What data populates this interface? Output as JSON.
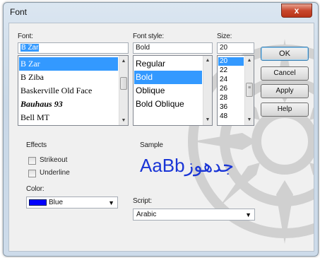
{
  "dialog": {
    "title": "Font",
    "close_label": "x"
  },
  "font": {
    "label": "Font:",
    "value": "B Zar",
    "items": [
      "B Zar",
      "B Ziba",
      "Baskerville Old Face",
      "Bauhaus 93",
      "Bell MT"
    ],
    "selected_index": 0
  },
  "style": {
    "label": "Font style:",
    "value": "Bold",
    "items": [
      "Regular",
      "Bold",
      "Oblique",
      "Bold Oblique"
    ],
    "selected_index": 1
  },
  "size": {
    "label": "Size:",
    "value": "20",
    "items": [
      "20",
      "22",
      "24",
      "26",
      "28",
      "36",
      "48"
    ],
    "selected_index": 0
  },
  "buttons": {
    "ok": "OK",
    "cancel": "Cancel",
    "apply": "Apply",
    "help": "Help"
  },
  "effects": {
    "label": "Effects",
    "strikeout": "Strikeout",
    "underline": "Underline",
    "strikeout_checked": false,
    "underline_checked": false,
    "color_label": "Color:",
    "color_value": "Blue",
    "color_hex": "#0000ff"
  },
  "sample": {
    "label": "Sample",
    "text": "AaBbجدهوز",
    "color": "#1a35d6"
  },
  "script": {
    "label": "Script:",
    "value": "Arabic"
  },
  "icons": {
    "scroll_up": "▲",
    "scroll_down": "▼",
    "dropdown": "▼",
    "thumb_grip": "≡"
  }
}
